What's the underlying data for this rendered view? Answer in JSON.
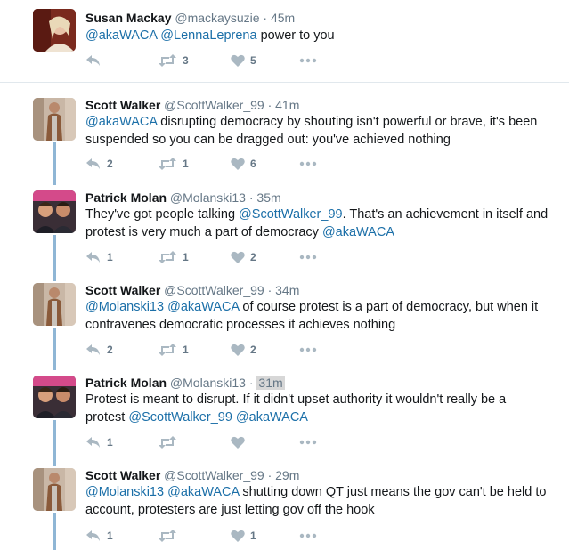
{
  "tweets": [
    {
      "name": "Susan Mackay",
      "handle": "@mackaysuzie",
      "time": "45m",
      "highlight": false,
      "text": [
        {
          "t": "@akaWACA",
          "m": true
        },
        {
          "t": " ",
          "m": false
        },
        {
          "t": "@LennaLeprena",
          "m": true
        },
        {
          "t": " power to you",
          "m": false
        }
      ],
      "replies": "",
      "retweets": "3",
      "likes": "5",
      "avatar": "susan"
    },
    {
      "name": "Scott Walker",
      "handle": "@ScottWalker_99",
      "time": "41m",
      "highlight": false,
      "text": [
        {
          "t": "@akaWACA",
          "m": true
        },
        {
          "t": " disrupting democracy by shouting isn't powerful or brave, it's been suspended so you can be dragged out: you've achieved nothing",
          "m": false
        }
      ],
      "replies": "2",
      "retweets": "1",
      "likes": "6",
      "avatar": "scott"
    },
    {
      "name": "Patrick Molan",
      "handle": "@Molanski13",
      "time": "35m",
      "highlight": false,
      "text": [
        {
          "t": "They've got people talking ",
          "m": false
        },
        {
          "t": "@ScottWalker_99",
          "m": true
        },
        {
          "t": ". That's an achievement in itself and protest is very much a part of democracy ",
          "m": false
        },
        {
          "t": "@akaWACA",
          "m": true
        }
      ],
      "replies": "1",
      "retweets": "1",
      "likes": "2",
      "avatar": "patrick"
    },
    {
      "name": "Scott Walker",
      "handle": "@ScottWalker_99",
      "time": "34m",
      "highlight": false,
      "text": [
        {
          "t": "@Molanski13",
          "m": true
        },
        {
          "t": " ",
          "m": false
        },
        {
          "t": "@akaWACA",
          "m": true
        },
        {
          "t": " of course protest is a part of democracy, but when it contravenes democratic processes it achieves nothing",
          "m": false
        }
      ],
      "replies": "2",
      "retweets": "1",
      "likes": "2",
      "avatar": "scott"
    },
    {
      "name": "Patrick Molan",
      "handle": "@Molanski13",
      "time": "31m",
      "highlight": true,
      "text": [
        {
          "t": "Protest is meant to disrupt. If it didn't upset authority it wouldn't really be a protest ",
          "m": false
        },
        {
          "t": "@ScottWalker_99",
          "m": true
        },
        {
          "t": " ",
          "m": false
        },
        {
          "t": "@akaWACA",
          "m": true
        }
      ],
      "replies": "1",
      "retweets": "",
      "likes": "",
      "avatar": "patrick"
    },
    {
      "name": "Scott Walker",
      "handle": "@ScottWalker_99",
      "time": "29m",
      "highlight": false,
      "text": [
        {
          "t": "@Molanski13",
          "m": true
        },
        {
          "t": " ",
          "m": false
        },
        {
          "t": "@akaWACA",
          "m": true
        },
        {
          "t": " shutting down QT just means the gov can't be held to account, protesters are just letting gov off the hook",
          "m": false
        }
      ],
      "replies": "1",
      "retweets": "",
      "likes": "1",
      "avatar": "scott"
    }
  ],
  "icons": {
    "reply": "reply-icon",
    "retweet": "retweet-icon",
    "like": "heart-icon",
    "more": "more-icon"
  },
  "colors": {
    "mention": "#1b6fa8",
    "thread_line": "#8fb6d5",
    "action_icon": "#aab8c2"
  }
}
